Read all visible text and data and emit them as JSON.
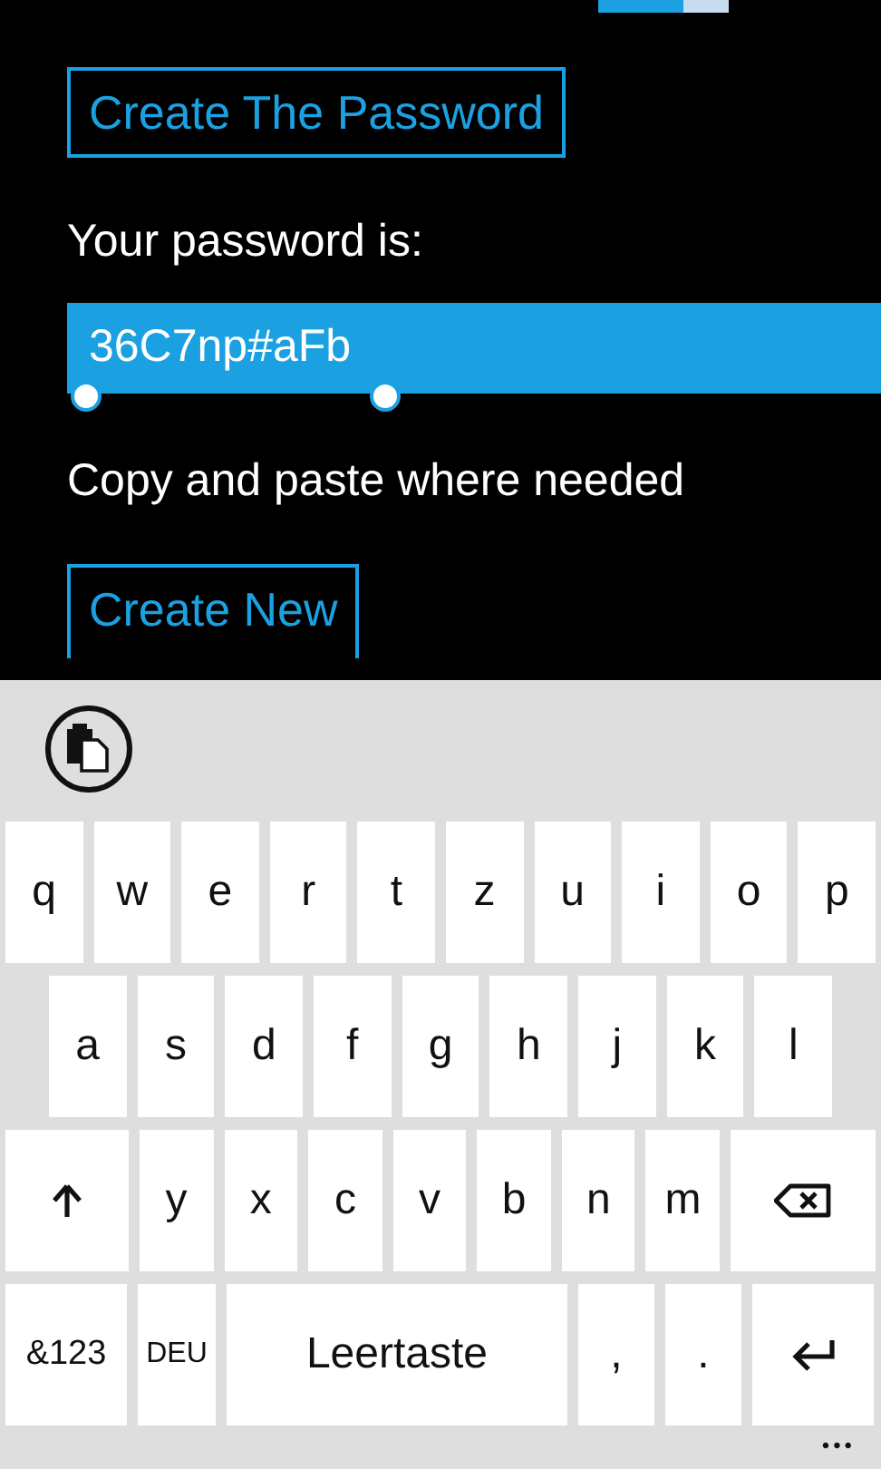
{
  "create_button": {
    "label": "Create The Password"
  },
  "result_label": "Your password is:",
  "password": {
    "value": "36C7np#aFb",
    "selected": true
  },
  "hint": "Copy and paste where needed",
  "new_button": {
    "label": "Create New"
  },
  "keyboard": {
    "rows": [
      {
        "keys": [
          {
            "kind": "char",
            "label": "q"
          },
          {
            "kind": "char",
            "label": "w"
          },
          {
            "kind": "char",
            "label": "e"
          },
          {
            "kind": "char",
            "label": "r"
          },
          {
            "kind": "char",
            "label": "t"
          },
          {
            "kind": "char",
            "label": "z"
          },
          {
            "kind": "char",
            "label": "u"
          },
          {
            "kind": "char",
            "label": "i"
          },
          {
            "kind": "char",
            "label": "o"
          },
          {
            "kind": "char",
            "label": "p"
          }
        ]
      },
      {
        "keys": [
          {
            "kind": "char",
            "label": "a"
          },
          {
            "kind": "char",
            "label": "s"
          },
          {
            "kind": "char",
            "label": "d"
          },
          {
            "kind": "char",
            "label": "f"
          },
          {
            "kind": "char",
            "label": "g"
          },
          {
            "kind": "char",
            "label": "h"
          },
          {
            "kind": "char",
            "label": "j"
          },
          {
            "kind": "char",
            "label": "k"
          },
          {
            "kind": "char",
            "label": "l"
          }
        ]
      },
      {
        "keys": [
          {
            "kind": "shift"
          },
          {
            "kind": "char",
            "label": "y"
          },
          {
            "kind": "char",
            "label": "x"
          },
          {
            "kind": "char",
            "label": "c"
          },
          {
            "kind": "char",
            "label": "v"
          },
          {
            "kind": "char",
            "label": "b"
          },
          {
            "kind": "char",
            "label": "n"
          },
          {
            "kind": "char",
            "label": "m"
          },
          {
            "kind": "backspace"
          }
        ]
      },
      {
        "keys": [
          {
            "kind": "symbols",
            "label": "&123"
          },
          {
            "kind": "language",
            "label": "DEU"
          },
          {
            "kind": "space",
            "label": "Leertaste"
          },
          {
            "kind": "char",
            "label": ","
          },
          {
            "kind": "char",
            "label": "."
          },
          {
            "kind": "enter"
          }
        ]
      }
    ],
    "more": "•••"
  }
}
